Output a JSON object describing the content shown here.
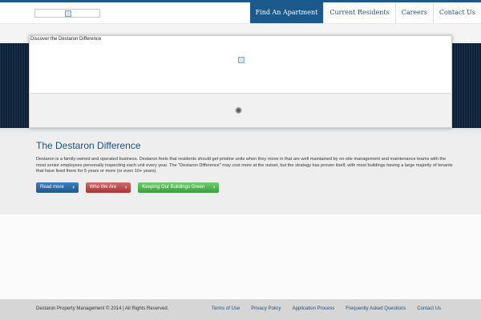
{
  "nav": {
    "items": [
      {
        "label": "Find An Apartment"
      },
      {
        "label": "Current Residents"
      },
      {
        "label": "Careers"
      },
      {
        "label": "Contact Us"
      }
    ]
  },
  "slider": {
    "caption": "Discover the Destaron Difference"
  },
  "content": {
    "title": "The Destaron Difference",
    "description": "Destaron is a family-owned and operated business. Destaron feels that residents should get pristine units when they move in that are well maintained by on-site management and maintenance teams with the most senior employees personally inspecting each unit every year. The \"Destaron Difference\" may cost more at the outset, but the strategy has proven itself, with most buildings having a large majority of tenants that have lived there for 5 years or more (or even 10+ years).",
    "buttons": {
      "read_more": "Read more",
      "who_we_are": "Who We Are",
      "green": "Keeping Our Buildings Green"
    }
  },
  "footer": {
    "copyright": "Destaron Property Management © 2014 | All Rights Reserved.",
    "links": [
      {
        "label": "Terms of Use"
      },
      {
        "label": "Privacy Policy"
      },
      {
        "label": "Application Process"
      },
      {
        "label": "Frequently Asked Questions"
      },
      {
        "label": "Contact Us"
      }
    ]
  },
  "colors": {
    "brand_blue": "#1d5a8c",
    "button_red": "#a63434",
    "button_green": "#3b9d3b"
  },
  "icons": {
    "arrow": "chevron-right-icon",
    "broken_image": "broken-image-icon",
    "loader": "loading-spinner-icon"
  }
}
